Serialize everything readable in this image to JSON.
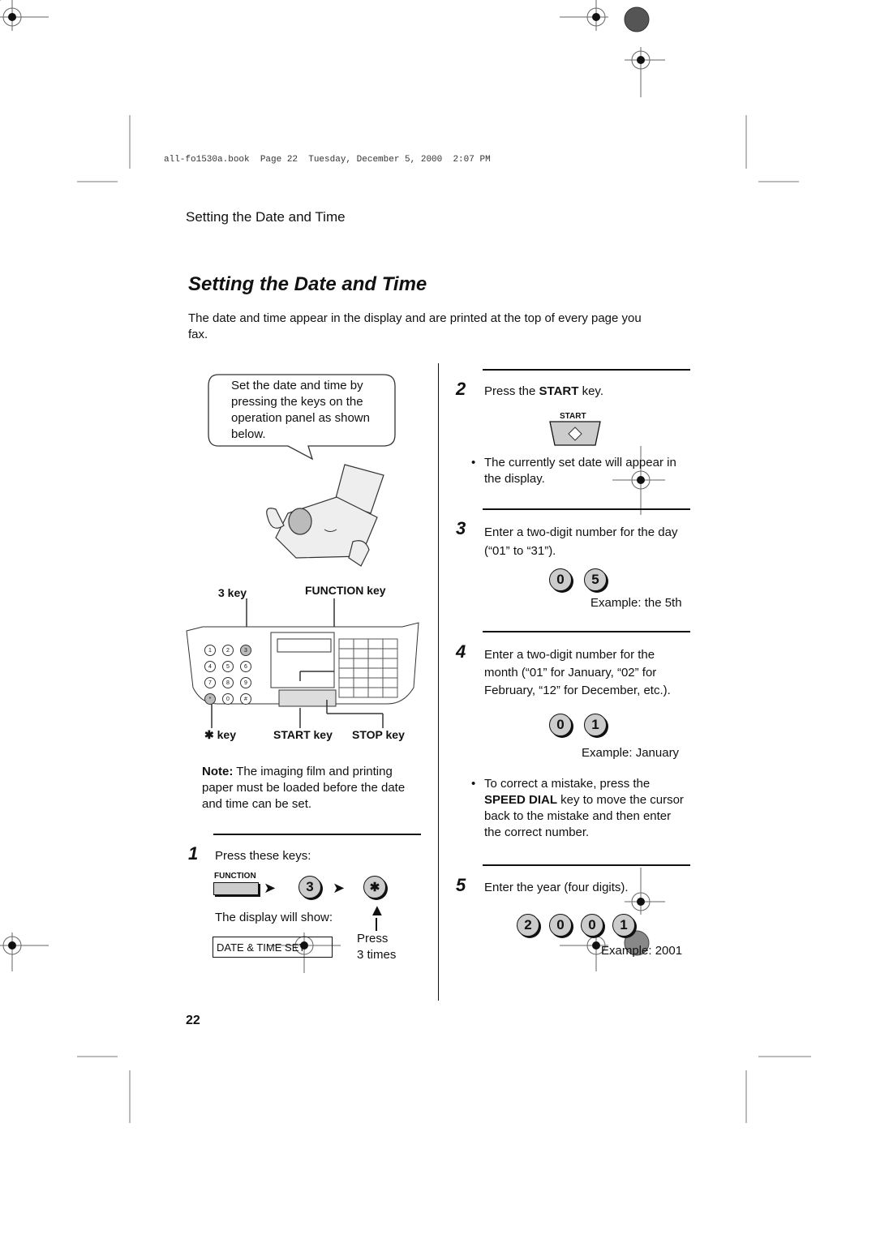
{
  "print_header": "all-fo1530a.book  Page 22  Tuesday, December 5, 2000  2:07 PM",
  "running_header": "Setting the Date and Time",
  "page_title": "Setting the Date and Time",
  "intro": "The date and time appear in the display and are printed at the top of every page you fax.",
  "callout": "Set the date and time by pressing the keys on the operation panel as shown below.",
  "panel_labels": {
    "three_key": "3 key",
    "function_key": "FUNCTION key",
    "star_key": "key",
    "start_key": "START key",
    "stop_key": "STOP key"
  },
  "note": {
    "label": "Note:",
    "text": " The imaging film and printing paper must be loaded before the date and time can be set."
  },
  "steps": [
    {
      "num": "1",
      "text": "Press these keys:",
      "function_label": "FUNCTION",
      "key3": "3",
      "display_caption": "The display will show:",
      "display_value": "DATE & TIME SET",
      "press_note_1": "Press",
      "press_note_2": "3 times"
    },
    {
      "num": "2",
      "text_pre": "Press the ",
      "text_bold": "START",
      "text_post": " key.",
      "key_label": "START",
      "bullet": "The currently set date will appear in the display."
    },
    {
      "num": "3",
      "text": "Enter a two-digit number for the day (“01” to “31”).",
      "keys": [
        "0",
        "5"
      ],
      "example": "Example: the 5th"
    },
    {
      "num": "4",
      "text": "Enter a two-digit number for the month (“01” for January, “02” for February, “12” for December, etc.).",
      "keys": [
        "0",
        "1"
      ],
      "example": "Example: January",
      "bullet_pre": "To correct a mistake, press the ",
      "bullet_bold": "SPEED DIAL",
      "bullet_post": " key to move the cursor back to the mistake and then enter the correct number."
    },
    {
      "num": "5",
      "text": "Enter the year (four digits).",
      "keys": [
        "2",
        "0",
        "0",
        "1"
      ],
      "example": "Example: 2001"
    }
  ],
  "page_number": "22",
  "keypad_digits": [
    "1",
    "2",
    "3",
    "4",
    "5",
    "6",
    "7",
    "8",
    "9",
    "*",
    "0",
    "#"
  ]
}
